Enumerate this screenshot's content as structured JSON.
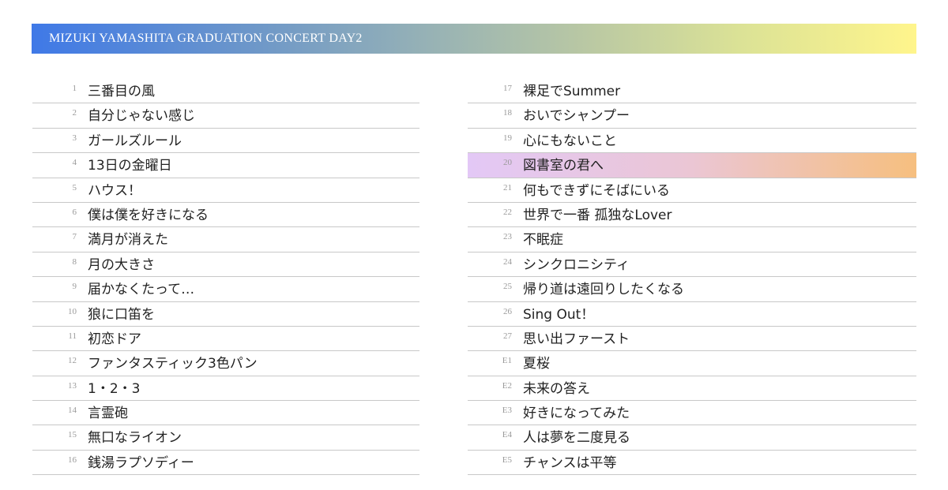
{
  "banner": {
    "title": "MIZUKI YAMASHITA GRADUATION CONCERT DAY2"
  },
  "setlist_left": [
    {
      "no": "1",
      "title": "三番目の風"
    },
    {
      "no": "2",
      "title": "自分じゃない感じ"
    },
    {
      "no": "3",
      "title": "ガールズルール"
    },
    {
      "no": "4",
      "title": "13日の金曜日"
    },
    {
      "no": "5",
      "title": "ハウス！"
    },
    {
      "no": "6",
      "title": "僕は僕を好きになる"
    },
    {
      "no": "7",
      "title": "満月が消えた"
    },
    {
      "no": "8",
      "title": "月の大きさ"
    },
    {
      "no": "9",
      "title": "届かなくたって…"
    },
    {
      "no": "10",
      "title": "狼に口笛を"
    },
    {
      "no": "11",
      "title": "初恋ドア"
    },
    {
      "no": "12",
      "title": "ファンタスティック3色パン"
    },
    {
      "no": "13",
      "title": "1・2・3"
    },
    {
      "no": "14",
      "title": "言霊砲"
    },
    {
      "no": "15",
      "title": "無口なライオン"
    },
    {
      "no": "16",
      "title": "銭湯ラプソディー"
    }
  ],
  "setlist_right": [
    {
      "no": "17",
      "title": "裸足でSummer"
    },
    {
      "no": "18",
      "title": "おいでシャンプー"
    },
    {
      "no": "19",
      "title": "心にもないこと"
    },
    {
      "no": "20",
      "title": "図書室の君へ",
      "highlight": true
    },
    {
      "no": "21",
      "title": "何もできずにそばにいる"
    },
    {
      "no": "22",
      "title": "世界で一番 孤独なLover"
    },
    {
      "no": "23",
      "title": "不眠症"
    },
    {
      "no": "24",
      "title": "シンクロニシティ"
    },
    {
      "no": "25",
      "title": "帰り道は遠回りしたくなる"
    },
    {
      "no": "26",
      "title": "Sing Out！"
    },
    {
      "no": "27",
      "title": "思い出ファースト"
    },
    {
      "no": "E1",
      "title": "夏桜"
    },
    {
      "no": "E2",
      "title": "未来の答え"
    },
    {
      "no": "E3",
      "title": "好きになってみた"
    },
    {
      "no": "E4",
      "title": "人は夢を二度見る"
    },
    {
      "no": "E5",
      "title": "チャンスは平等"
    }
  ],
  "colors": {
    "banner_gradient": [
      "#3f79e7",
      "#97b2b5",
      "#fff58c"
    ],
    "highlight_gradient": [
      "#e3c8f6",
      "#ebc6d4",
      "#f6bf7f"
    ],
    "divider": "#c8c8c8"
  }
}
